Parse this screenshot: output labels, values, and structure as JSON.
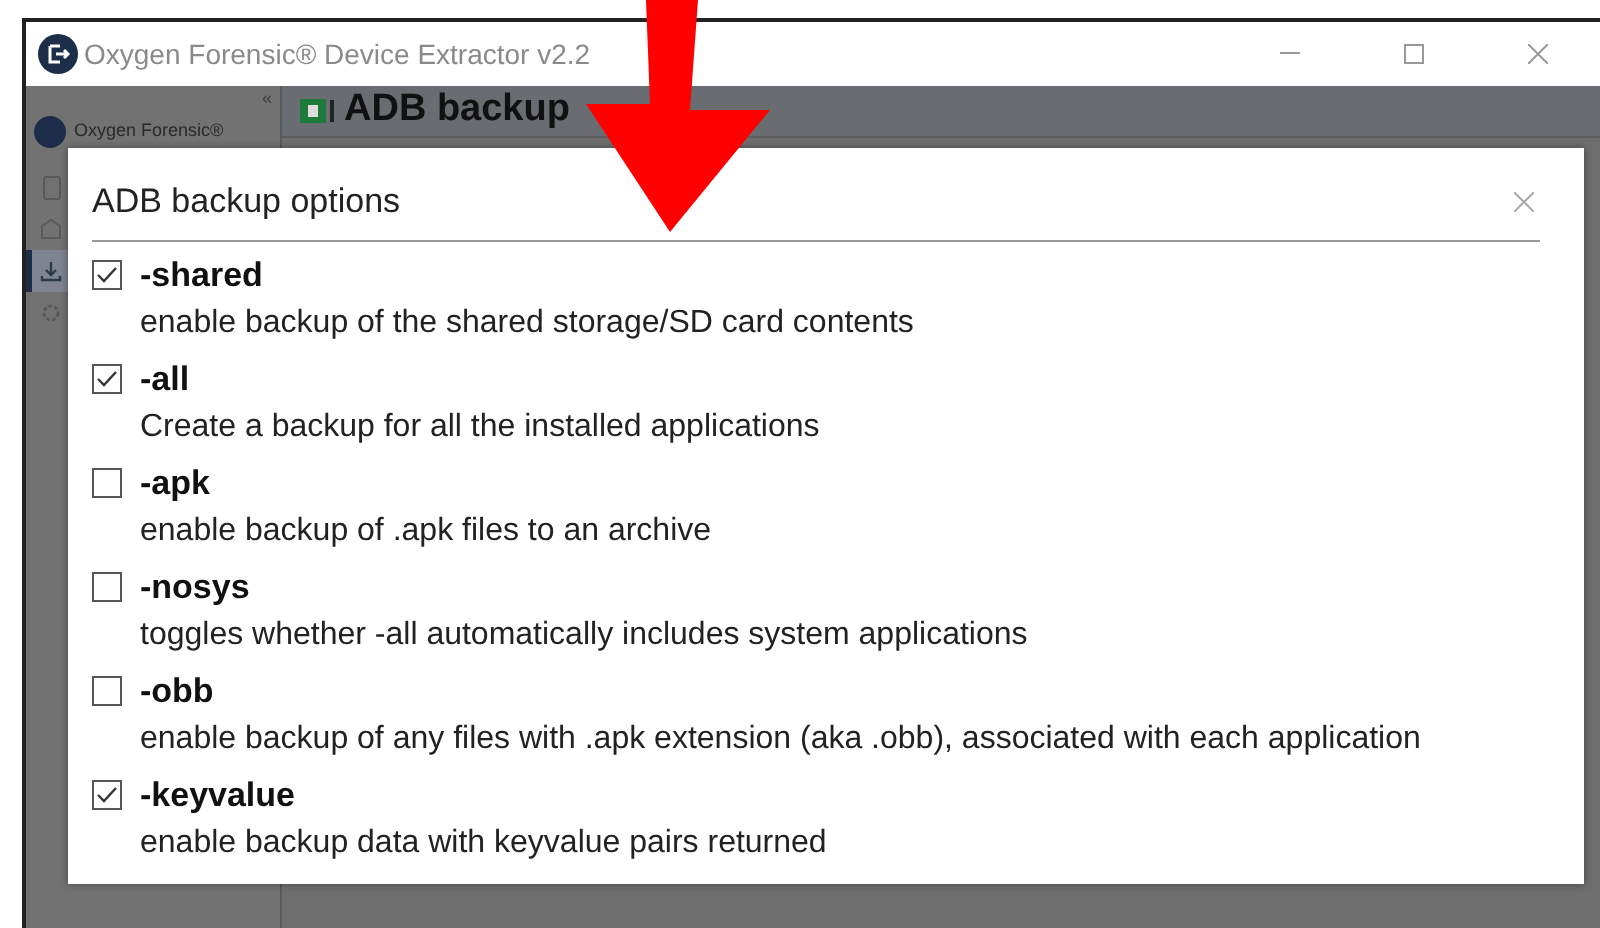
{
  "window": {
    "title": "Oxygen Forensic® Device Extractor v2.2"
  },
  "sidebar": {
    "collapse": "«",
    "brand": "Oxygen Forensic®",
    "items": [
      {
        "kind": "phone",
        "selected": false
      },
      {
        "kind": "building",
        "selected": false
      },
      {
        "kind": "download",
        "selected": true
      },
      {
        "kind": "gear",
        "selected": false
      }
    ]
  },
  "header": {
    "title": "ADB backup"
  },
  "dialog": {
    "title": "ADB backup options",
    "options": [
      {
        "name": "-shared",
        "description": "enable backup of the shared storage/SD card contents",
        "checked": true
      },
      {
        "name": "-all",
        "description": "Create a backup for all the installed applications",
        "checked": true
      },
      {
        "name": "-apk",
        "description": "enable backup of .apk files to an archive",
        "checked": false
      },
      {
        "name": "-nosys",
        "description": "toggles whether -all automatically includes system applications",
        "checked": false
      },
      {
        "name": "-obb",
        "description": "enable backup of any files with .apk extension (aka .obb), associated with each application",
        "checked": false
      },
      {
        "name": "-keyvalue",
        "description": "enable backup data with keyvalue pairs returned",
        "checked": true
      }
    ]
  }
}
